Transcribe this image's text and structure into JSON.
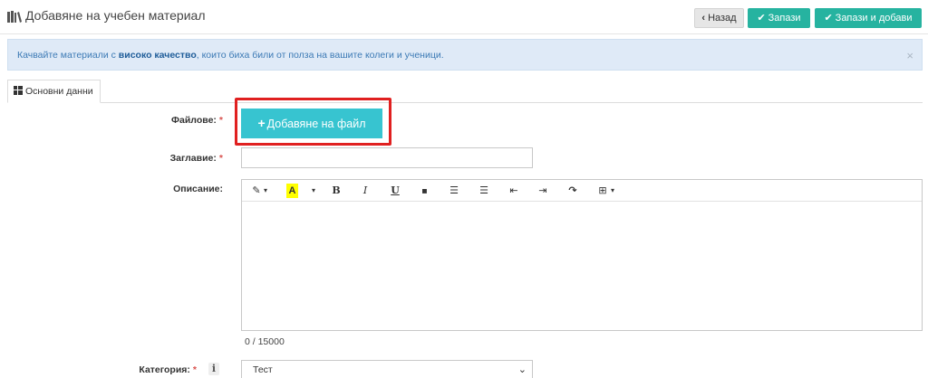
{
  "header": {
    "title": "Добавяне на учебен материал",
    "back_label": "Назад",
    "save_label": "Запази",
    "save_add_label": "Запази и добави"
  },
  "alert": {
    "text_before": "Качвайте материали с ",
    "text_bold": "високо качество",
    "text_after": ", които биха били от полза на вашите колеги и ученици.",
    "close_glyph": "×"
  },
  "tabs": [
    {
      "label": "Основни данни"
    }
  ],
  "form": {
    "files_label": "Файлове:",
    "add_file_label": "Добавяне на файл",
    "title_label": "Заглавие:",
    "title_value": "",
    "description_label": "Описание:",
    "description_value": "",
    "char_counter": "0 / 15000",
    "category_label": "Категория:",
    "category_value": "Тест",
    "required_mark": "*"
  },
  "toolbar_glyphs": {
    "magic": "✎",
    "highlight": "A",
    "bold": "B",
    "italic": "I",
    "underline": "U",
    "eraser": "◆",
    "ul": "☰",
    "ol": "☰",
    "outdent": "⇤",
    "indent": "⇥",
    "redo": "↷",
    "table": "⊞",
    "caret": "▾"
  },
  "colors": {
    "accent": "#26b3a0",
    "add_file": "#37c4d0",
    "alert_bg": "#dfeaf7",
    "highlight_border": "#e02020",
    "required": "#d9534f"
  }
}
